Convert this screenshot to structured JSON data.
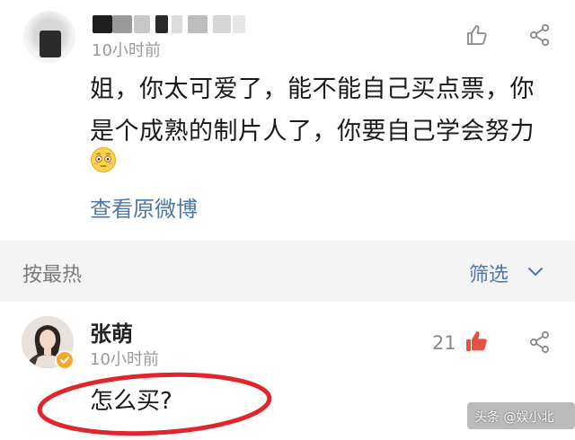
{
  "post": {
    "time": "10小时前",
    "text": "姐，你太可爱了，能不能自己买点票，你是个成熟的制片人了，你要自己学会努力",
    "view_original": "查看原微博"
  },
  "filter_bar": {
    "sort_label": "按最热",
    "filter_label": "筛选"
  },
  "comment": {
    "user_name": "张萌",
    "time": "10小时前",
    "like_count": "21",
    "text": "怎么买?"
  },
  "watermark": "头条 @娱小北",
  "colors": {
    "link": "#4f77a8",
    "like_active": "#e8513c",
    "highlight_ellipse": "#e0262c",
    "separator": "#f4f4f4"
  },
  "icons": [
    "thumbs-up-icon",
    "share-icon",
    "chevron-down-icon",
    "flushed-emoji-icon",
    "verified-badge-icon"
  ]
}
